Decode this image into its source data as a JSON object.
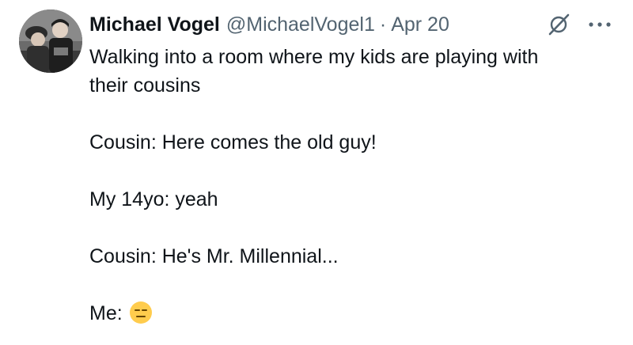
{
  "author": {
    "display_name": "Michael Vogel",
    "handle": "@MichaelVogel1",
    "separator": "·",
    "date": "Apr 20"
  },
  "icons": {
    "grok": "grok-icon",
    "more": "more-options-icon",
    "emoji": "expressionless-face-emoji-icon"
  },
  "colors": {
    "text": "#0f1419",
    "secondary": "#536471",
    "emoji_face": "#ffcc4d"
  },
  "tweet": {
    "lines": [
      "Walking into a room where my kids are playing with",
      "their cousins",
      "Cousin: Here comes the old guy!",
      "My 14yo: yeah",
      "Cousin: He's Mr. Millennial...",
      "Me:"
    ]
  }
}
